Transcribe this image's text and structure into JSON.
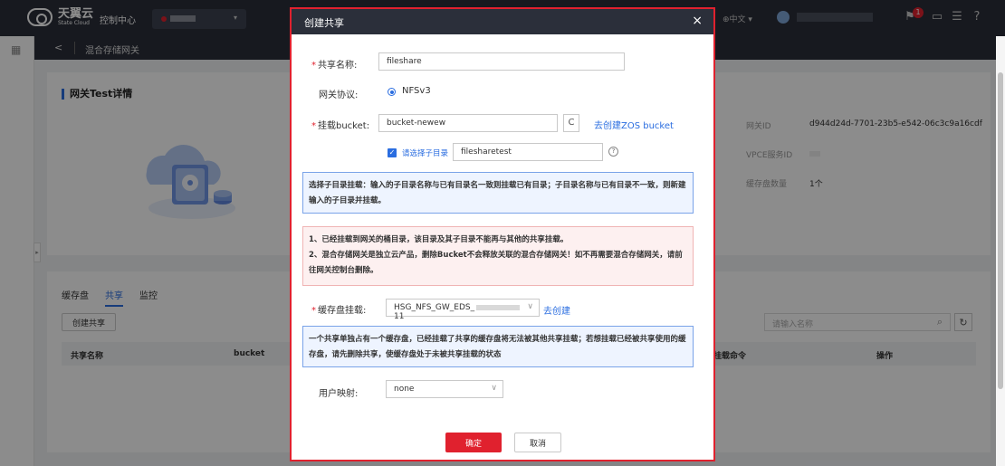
{
  "topbar": {
    "logo_cn": "天翼云",
    "logo_en": "State Cloud",
    "console": "控制中心",
    "lang": "中文",
    "notification_count": "1"
  },
  "breadcrumb": {
    "back": "<",
    "title": "混合存储网关"
  },
  "detail_card": {
    "title": "网关Test详情",
    "info": [
      {
        "label": "网关ID",
        "value": "d944d24d-7701-23b5-e542-06c3c9a16cdf"
      },
      {
        "label": "VPCE服务ID",
        "value": ""
      },
      {
        "label": "缓存盘数量",
        "value": "1个"
      }
    ]
  },
  "list_card": {
    "tabs": [
      "缓存盘",
      "共享",
      "监控"
    ],
    "active_tab": "共享",
    "create_button": "创建共享",
    "search_placeholder": "请输入名称",
    "columns": [
      "共享名称",
      "bucket",
      "挂载命令",
      "操作"
    ]
  },
  "modal": {
    "title": "创建共享",
    "close": "×",
    "share_name_label": "共享名称:",
    "share_name_value": "fileshare",
    "protocol_label": "网关协议:",
    "protocol_value": "NFSv3",
    "bucket_label": "挂载bucket:",
    "bucket_value": "bucket-newew",
    "refresh": "C",
    "create_bucket_link": "去创建ZOS bucket",
    "subdir_label": "请选择子目录",
    "subdir_value": "filesharetest",
    "help": "?",
    "note_subdir": "选择子目录挂载：输入的子目录名称与已有目录名一致则挂载已有目录；子目录名称与已有目录不一致，则新建输入的子目录并挂载。",
    "warning_lines": [
      "1、已经挂载到网关的桶目录，该目录及其子目录不能再与其他的共享挂载。",
      "2、混合存储网关是独立云产品，删除Bucket不会释放关联的混合存储网关！如不再需要混合存储网关，请前往网关控制台删除。"
    ],
    "cache_label": "缓存盘挂载:",
    "cache_value_prefix": "HSG_NFS_GW_EDS_",
    "cache_value_suffix": "11",
    "cache_create_link": "去创建",
    "note_cache": "一个共享单独占有一个缓存盘，已经挂载了共享的缓存盘将无法被其他共享挂载；若想挂载已经被共享使用的缓存盘，请先删除共享，使缓存盘处于未被共享挂载的状态",
    "user_map_label": "用户映射:",
    "user_map_value": "none",
    "ok": "确定",
    "cancel": "取消"
  }
}
